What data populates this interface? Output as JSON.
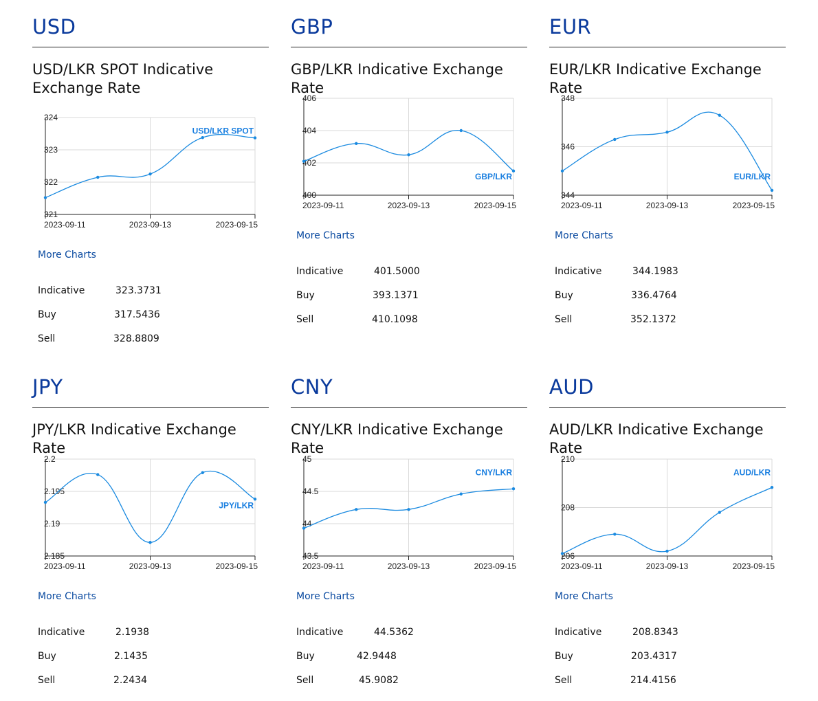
{
  "panels": [
    {
      "currency": "USD",
      "title": "USD/LKR SPOT Indicative Exchange Rate",
      "more_charts": "More Charts",
      "rates": [
        {
          "label": "Indicative",
          "value": "323.3731"
        },
        {
          "label": "Buy",
          "value": "317.5436"
        },
        {
          "label": "Sell",
          "value": "328.8809"
        }
      ]
    },
    {
      "currency": "GBP",
      "title": "GBP/LKR Indicative Exchange Rate",
      "more_charts": "More Charts",
      "rates": [
        {
          "label": "Indicative",
          "value": "401.5000"
        },
        {
          "label": "Buy",
          "value": "393.1371"
        },
        {
          "label": "Sell",
          "value": "410.1098"
        }
      ]
    },
    {
      "currency": "EUR",
      "title": "EUR/LKR Indicative Exchange Rate",
      "more_charts": "More Charts",
      "rates": [
        {
          "label": "Indicative",
          "value": "344.1983"
        },
        {
          "label": "Buy",
          "value": "336.4764"
        },
        {
          "label": "Sell",
          "value": "352.1372"
        }
      ]
    },
    {
      "currency": "JPY",
      "title": "JPY/LKR Indicative Exchange Rate",
      "more_charts": "More Charts",
      "rates": [
        {
          "label": "Indicative",
          "value": "2.1938"
        },
        {
          "label": "Buy",
          "value": "2.1435"
        },
        {
          "label": "Sell",
          "value": "2.2434"
        }
      ]
    },
    {
      "currency": "CNY",
      "title": "CNY/LKR Indicative Exchange Rate",
      "more_charts": "More Charts",
      "rates": [
        {
          "label": "Indicative",
          "value": "44.5362"
        },
        {
          "label": "Buy",
          "value": "42.9448"
        },
        {
          "label": "Sell",
          "value": "45.9082"
        }
      ]
    },
    {
      "currency": "AUD",
      "title": "AUD/LKR Indicative Exchange Rate",
      "more_charts": "More Charts",
      "rates": [
        {
          "label": "Indicative",
          "value": "208.8343"
        },
        {
          "label": "Buy",
          "value": "203.4317"
        },
        {
          "label": "Sell",
          "value": "214.4156"
        }
      ]
    }
  ],
  "colors": {
    "line": "#1a8ae0",
    "label": "#1a7fe0",
    "grid": "#d9d9d9",
    "currency": "#0a3a9c",
    "link": "#0a4aa0"
  },
  "chart_data": [
    {
      "type": "line",
      "series": [
        {
          "name": "USD/LKR SPOT",
          "x": [
            "2023-09-11",
            "2023-09-12",
            "2023-09-13",
            "2023-09-14",
            "2023-09-15"
          ],
          "values": [
            321.52,
            322.15,
            322.25,
            323.38,
            323.37
          ]
        }
      ],
      "x_tick_labels": [
        "2023-09-11",
        "2023-09-13",
        "2023-09-15"
      ],
      "y_ticks": [
        321,
        322,
        323,
        324
      ],
      "ylim": [
        321,
        324
      ],
      "grid": true,
      "legend": "top-right"
    },
    {
      "type": "line",
      "series": [
        {
          "name": "GBP/LKR",
          "x": [
            "2023-09-11",
            "2023-09-12",
            "2023-09-13",
            "2023-09-14",
            "2023-09-15"
          ],
          "values": [
            402.1,
            403.2,
            402.5,
            404.0,
            401.5
          ]
        }
      ],
      "x_tick_labels": [
        "2023-09-11",
        "2023-09-13",
        "2023-09-15"
      ],
      "y_ticks": [
        400,
        402,
        404,
        406
      ],
      "ylim": [
        400,
        406
      ],
      "grid": true,
      "legend": "bottom-right"
    },
    {
      "type": "line",
      "series": [
        {
          "name": "EUR/LKR",
          "x": [
            "2023-09-11",
            "2023-09-12",
            "2023-09-13",
            "2023-09-14",
            "2023-09-15"
          ],
          "values": [
            345.0,
            346.3,
            346.6,
            347.3,
            344.2
          ]
        }
      ],
      "x_tick_labels": [
        "2023-09-11",
        "2023-09-13",
        "2023-09-15"
      ],
      "y_ticks": [
        344,
        346,
        348
      ],
      "ylim": [
        344,
        348
      ],
      "grid": true,
      "legend": "bottom-right"
    },
    {
      "type": "line",
      "series": [
        {
          "name": "JPY/LKR",
          "x": [
            "2023-09-11",
            "2023-09-12",
            "2023-09-13",
            "2023-09-14",
            "2023-09-15"
          ],
          "values": [
            2.1933,
            2.1976,
            2.1871,
            2.1979,
            2.1938
          ]
        }
      ],
      "x_tick_labels": [
        "2023-09-11",
        "2023-09-13",
        "2023-09-15"
      ],
      "y_ticks": [
        2.185,
        2.19,
        2.195,
        2.2
      ],
      "ylim": [
        2.185,
        2.2
      ],
      "grid": true,
      "legend": "middle-right"
    },
    {
      "type": "line",
      "series": [
        {
          "name": "CNY/LKR",
          "x": [
            "2023-09-11",
            "2023-09-12",
            "2023-09-13",
            "2023-09-14",
            "2023-09-15"
          ],
          "values": [
            43.93,
            44.22,
            44.22,
            44.46,
            44.54
          ]
        }
      ],
      "x_tick_labels": [
        "2023-09-11",
        "2023-09-13",
        "2023-09-15"
      ],
      "y_ticks": [
        43.5,
        44,
        44.5,
        45
      ],
      "ylim": [
        43.5,
        45
      ],
      "grid": true,
      "legend": "top-right"
    },
    {
      "type": "line",
      "series": [
        {
          "name": "AUD/LKR",
          "x": [
            "2023-09-11",
            "2023-09-12",
            "2023-09-13",
            "2023-09-14",
            "2023-09-15"
          ],
          "values": [
            206.1,
            206.9,
            206.2,
            207.8,
            208.83
          ]
        }
      ],
      "x_tick_labels": [
        "2023-09-11",
        "2023-09-13",
        "2023-09-15"
      ],
      "y_ticks": [
        206,
        208,
        210
      ],
      "ylim": [
        206,
        210
      ],
      "grid": true,
      "legend": "top-right"
    }
  ]
}
